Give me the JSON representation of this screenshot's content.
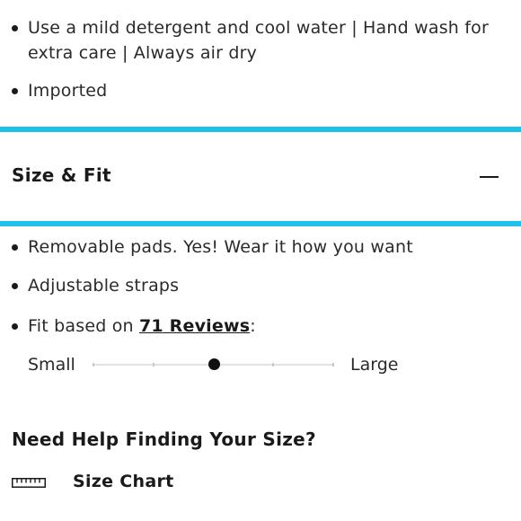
{
  "care_list": {
    "items": [
      {
        "text": "Use a mild detergent and cool water | Hand wash for extra care | Always air dry"
      },
      {
        "text": "Imported"
      }
    ]
  },
  "size_fit": {
    "title": "Size & Fit",
    "toggle_icon": "minus-icon",
    "expanded": true,
    "bullets": [
      {
        "text": "Removable pads. Yes! Wear it how you want"
      },
      {
        "text": "Adjustable straps"
      }
    ],
    "fit_reviews": {
      "prefix": "Fit based on ",
      "link_text": "71 Reviews",
      "suffix": ":"
    },
    "fit_scale": {
      "min_label": "Small",
      "max_label": "Large",
      "steps": 5,
      "value_step": 3
    }
  },
  "size_help": {
    "heading": "Need Help Finding Your Size?",
    "link_label": "Size Chart",
    "link_icon": "ruler-icon"
  },
  "colors": {
    "accent_divider": "#1ec1ec",
    "text": "#222222"
  }
}
